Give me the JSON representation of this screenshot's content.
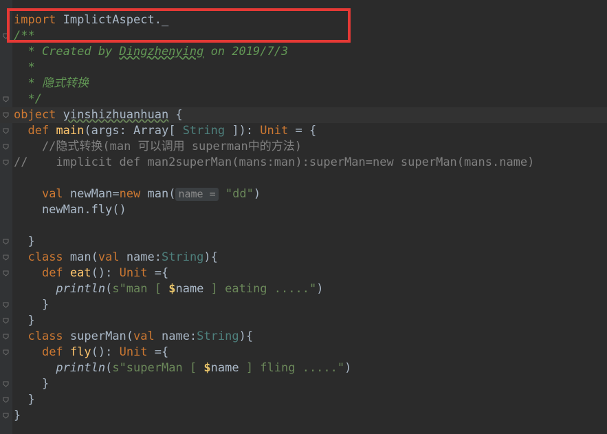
{
  "editor": {
    "lines": [
      {
        "id": "l1",
        "segments": [
          {
            "t": "import ",
            "c": "kw"
          },
          {
            "t": "ImplictAspect._",
            "c": ""
          }
        ]
      },
      {
        "id": "l2",
        "segments": [
          {
            "t": "/**",
            "c": "doc"
          }
        ]
      },
      {
        "id": "l3",
        "segments": [
          {
            "t": "  * Created by ",
            "c": "doc"
          },
          {
            "t": "Dingzhenying",
            "c": "doc-u"
          },
          {
            "t": " on 2019/7/3",
            "c": "doc"
          }
        ]
      },
      {
        "id": "l4",
        "segments": [
          {
            "t": "  *",
            "c": "doc"
          }
        ]
      },
      {
        "id": "l5",
        "segments": [
          {
            "t": "  * 隐式转换",
            "c": "doc"
          }
        ]
      },
      {
        "id": "l6",
        "segments": [
          {
            "t": "  */",
            "c": "doc"
          }
        ]
      },
      {
        "id": "l7",
        "segments": [
          {
            "t": "object ",
            "c": "kw"
          },
          {
            "t": "yinshizhuanhuan",
            "c": "obj"
          },
          {
            "t": " {",
            "c": ""
          }
        ]
      },
      {
        "id": "l8",
        "segments": [
          {
            "t": "  ",
            "c": ""
          },
          {
            "t": "def ",
            "c": "kw"
          },
          {
            "t": "main",
            "c": "fn"
          },
          {
            "t": "(args: Array[ ",
            "c": ""
          },
          {
            "t": "String",
            "c": "tyg"
          },
          {
            "t": " ]): ",
            "c": ""
          },
          {
            "t": "Unit",
            "c": "kw"
          },
          {
            "t": " = {",
            "c": ""
          }
        ]
      },
      {
        "id": "l9",
        "segments": [
          {
            "t": "    //隐式转换(man 可以调用 superman中的方法)",
            "c": "cm"
          }
        ]
      },
      {
        "id": "l10",
        "segments": [
          {
            "t": "//    implicit def man2superMan(mans:man):superMan=new superMan(mans.name)",
            "c": "cm"
          }
        ]
      },
      {
        "id": "l11",
        "segments": []
      },
      {
        "id": "l12",
        "segments": [
          {
            "t": "    ",
            "c": ""
          },
          {
            "t": "val ",
            "c": "kw"
          },
          {
            "t": "newMan=",
            "c": ""
          },
          {
            "t": "new ",
            "c": "kw"
          },
          {
            "t": "man(",
            "c": ""
          },
          {
            "t": "name =",
            "c": "hint"
          },
          {
            "t": " ",
            "c": ""
          },
          {
            "t": "\"dd\"",
            "c": "str"
          },
          {
            "t": ")",
            "c": ""
          }
        ]
      },
      {
        "id": "l13",
        "segments": [
          {
            "t": "    newMan.fly()",
            "c": ""
          }
        ]
      },
      {
        "id": "l14",
        "segments": []
      },
      {
        "id": "l15",
        "segments": [
          {
            "t": "  }",
            "c": ""
          }
        ]
      },
      {
        "id": "l16",
        "segments": [
          {
            "t": "  ",
            "c": ""
          },
          {
            "t": "class ",
            "c": "kw"
          },
          {
            "t": "man(",
            "c": ""
          },
          {
            "t": "val ",
            "c": "kw"
          },
          {
            "t": "name:",
            "c": ""
          },
          {
            "t": "String",
            "c": "tyg"
          },
          {
            "t": "){",
            "c": ""
          }
        ]
      },
      {
        "id": "l17",
        "segments": [
          {
            "t": "    ",
            "c": ""
          },
          {
            "t": "def ",
            "c": "kw"
          },
          {
            "t": "eat",
            "c": "fn"
          },
          {
            "t": "(): ",
            "c": ""
          },
          {
            "t": "Unit",
            "c": "kw"
          },
          {
            "t": " ={",
            "c": ""
          }
        ]
      },
      {
        "id": "l18",
        "segments": [
          {
            "t": "      ",
            "c": ""
          },
          {
            "t": "println",
            "c": "it"
          },
          {
            "t": "(",
            "c": ""
          },
          {
            "t": "s\"man [ ",
            "c": "str"
          },
          {
            "t": "$",
            "c": "dollar"
          },
          {
            "t": "name",
            "c": ""
          },
          {
            "t": " ] eating .....\"",
            "c": "str"
          },
          {
            "t": ")",
            "c": ""
          }
        ]
      },
      {
        "id": "l19",
        "segments": [
          {
            "t": "    }",
            "c": ""
          }
        ]
      },
      {
        "id": "l20",
        "segments": [
          {
            "t": "  }",
            "c": ""
          }
        ]
      },
      {
        "id": "l21",
        "segments": [
          {
            "t": "  ",
            "c": ""
          },
          {
            "t": "class ",
            "c": "kw"
          },
          {
            "t": "superMan(",
            "c": ""
          },
          {
            "t": "val ",
            "c": "kw"
          },
          {
            "t": "name:",
            "c": ""
          },
          {
            "t": "String",
            "c": "tyg"
          },
          {
            "t": "){",
            "c": ""
          }
        ]
      },
      {
        "id": "l22",
        "segments": [
          {
            "t": "    ",
            "c": ""
          },
          {
            "t": "def ",
            "c": "kw"
          },
          {
            "t": "fly",
            "c": "fn"
          },
          {
            "t": "(): ",
            "c": ""
          },
          {
            "t": "Unit",
            "c": "kw"
          },
          {
            "t": " ={",
            "c": ""
          }
        ]
      },
      {
        "id": "l23",
        "segments": [
          {
            "t": "      ",
            "c": ""
          },
          {
            "t": "println",
            "c": "it"
          },
          {
            "t": "(",
            "c": ""
          },
          {
            "t": "s\"superMan [ ",
            "c": "str"
          },
          {
            "t": "$",
            "c": "dollar"
          },
          {
            "t": "name",
            "c": ""
          },
          {
            "t": " ] fling .....\"",
            "c": "str"
          },
          {
            "t": ")",
            "c": ""
          }
        ]
      },
      {
        "id": "l24",
        "segments": [
          {
            "t": "    }",
            "c": ""
          }
        ]
      },
      {
        "id": "l25",
        "segments": [
          {
            "t": "  }",
            "c": ""
          }
        ]
      },
      {
        "id": "l26",
        "segments": [
          {
            "t": "}",
            "c": ""
          }
        ]
      }
    ],
    "fold_markers_on": [
      "l2",
      "l6",
      "l7",
      "l8",
      "l9",
      "l10",
      "l15",
      "l16",
      "l17",
      "l19",
      "l20",
      "l21",
      "l22",
      "l24",
      "l25",
      "l26"
    ],
    "caret_line": "l7"
  },
  "colors": {
    "background": "#2b2b2b",
    "keyword": "#cc7832",
    "function": "#ffc66d",
    "string": "#6a8759",
    "comment": "#808080",
    "doc_comment": "#629755",
    "highlight_box": "#e53935"
  }
}
